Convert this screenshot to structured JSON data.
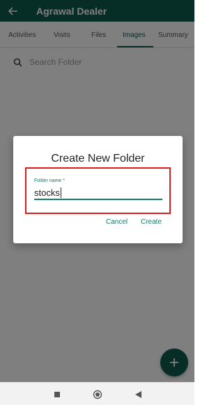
{
  "appbar": {
    "title": "Agrawal Dealer",
    "back_icon": "back-arrow-icon"
  },
  "tabs": [
    {
      "label": "Activities"
    },
    {
      "label": "Visits"
    },
    {
      "label": "Files"
    },
    {
      "label": "Images",
      "active": true
    },
    {
      "label": "Summary"
    }
  ],
  "search": {
    "placeholder": "Search Folder",
    "icon": "search-icon"
  },
  "dialog": {
    "title": "Create New Folder",
    "field_label": "Folder name *",
    "field_value": "stocks",
    "cancel_label": "Cancel",
    "create_label": "Create"
  },
  "fab": {
    "icon": "plus-icon"
  },
  "colors": {
    "primary": "#0f5b4f",
    "accent": "#0f7d6a",
    "highlight": "#e01b1b"
  }
}
